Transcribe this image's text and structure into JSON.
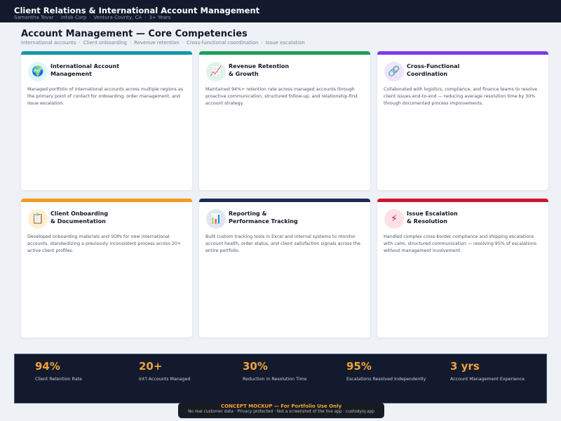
{
  "header": {
    "title": "Client Relations & International Account Management",
    "meta": [
      "Samantha Tovar",
      "Infab Corp",
      "Ventura County, CA",
      "3+ Years"
    ]
  },
  "main": {
    "title": "Account Management — Core Competencies",
    "tags": [
      "International accounts",
      "Client onboarding",
      "Revenue retention",
      "Cross-functional coordination",
      "Issue escalation"
    ]
  },
  "cards": [
    {
      "title_line1": "International Account",
      "title_line2": "Management",
      "icon": "globe-icon",
      "icon_glyph": "🌍",
      "accent": "#1597a8",
      "icon_bg": "#dff6f8",
      "desc": "Managed portfolio of international accounts across multiple regions as the primary point of contact for onboarding, order management, and issue escalation."
    },
    {
      "title_line1": "Revenue Retention",
      "title_line2": "& Growth",
      "icon": "chart-icon",
      "icon_glyph": "📈",
      "accent": "#18a058",
      "icon_bg": "#dff5e8",
      "desc": "Maintained 94%+ retention rate across managed accounts through proactive communication, structured follow-up, and relationship-first account strategy."
    },
    {
      "title_line1": "Cross-Functional",
      "title_line2": "Coordination",
      "icon": "link-icon",
      "icon_glyph": "🔗",
      "accent": "#7c3aed",
      "icon_bg": "#ece5fb",
      "desc": "Collaborated with logistics, compliance, and finance teams to resolve client issues end-to-end — reducing average resolution time by 30% through documented process improvements."
    },
    {
      "title_line1": "Client Onboarding",
      "title_line2": "& Documentation",
      "icon": "clipboard-icon",
      "icon_glyph": "📋",
      "accent": "#f29b1d",
      "icon_bg": "#fdf0d2",
      "desc": "Developed onboarding materials and SOPs for new international accounts, standardizing a previously inconsistent process across 20+ active client profiles."
    },
    {
      "title_line1": "Reporting &",
      "title_line2": "Performance Tracking",
      "icon": "bar-chart-icon",
      "icon_glyph": "📊",
      "accent": "#1b2b55",
      "icon_bg": "#e1e6f1",
      "desc": "Built custom tracking tools in Excel and internal systems to monitor account health, order status, and client satisfaction signals across the entire portfolio."
    },
    {
      "title_line1": "Issue Escalation",
      "title_line2": "& Resolution",
      "icon": "lightning-icon",
      "icon_glyph": "⚡",
      "accent": "#d0142c",
      "icon_bg": "#fde1e6",
      "desc": "Handled complex cross-border compliance and shipping escalations with calm, structured communication — resolving 95% of escalations without management involvement."
    }
  ],
  "stats": [
    {
      "value": "94%",
      "label": "Client Retention Rate"
    },
    {
      "value": "20+",
      "label": "Int'l Accounts Managed"
    },
    {
      "value": "30%",
      "label": "Reduction in Resolution Time"
    },
    {
      "value": "95%",
      "label": "Escalations Resolved Independently"
    },
    {
      "value": "3 yrs",
      "label": "Account Management Experience"
    }
  ],
  "footer": {
    "headline": "CONCEPT MOCKUP — For Portfolio Use Only",
    "note": "No real customer data · Privacy protected · Not a screenshot of the live app · custodyiq.app"
  }
}
